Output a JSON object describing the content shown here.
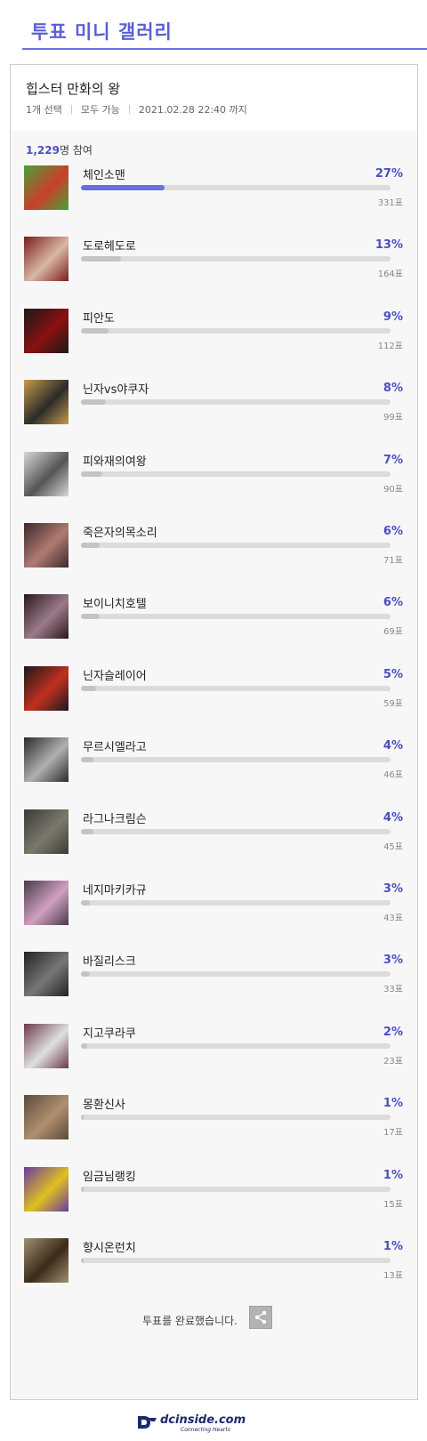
{
  "header": {
    "title": "투표 미니 갤러리"
  },
  "poll": {
    "title": "힙스터 만화의 왕",
    "select_rule": "1개 선택",
    "visibility": "모두 가능",
    "deadline": "2021.02.28 22:40 까지",
    "participants_count": "1,229",
    "participants_suffix": "명 참여",
    "options": [
      {
        "label": "체인소맨",
        "percent": "27%",
        "votes": "331표",
        "fraction": 0.27
      },
      {
        "label": "도로헤도로",
        "percent": "13%",
        "votes": "164표",
        "fraction": 0.13
      },
      {
        "label": "피안도",
        "percent": "9%",
        "votes": "112표",
        "fraction": 0.09
      },
      {
        "label": "닌자vs야쿠자",
        "percent": "8%",
        "votes": "99표",
        "fraction": 0.08
      },
      {
        "label": "피와재의여왕",
        "percent": "7%",
        "votes": "90표",
        "fraction": 0.07
      },
      {
        "label": "죽은자의목소리",
        "percent": "6%",
        "votes": "71표",
        "fraction": 0.06
      },
      {
        "label": "보이니치호텔",
        "percent": "6%",
        "votes": "69표",
        "fraction": 0.06
      },
      {
        "label": "닌자슬레이어",
        "percent": "5%",
        "votes": "59표",
        "fraction": 0.05
      },
      {
        "label": "무르시엘라고",
        "percent": "4%",
        "votes": "46표",
        "fraction": 0.04
      },
      {
        "label": "라그나크림슨",
        "percent": "4%",
        "votes": "45표",
        "fraction": 0.04
      },
      {
        "label": "네지마키카규",
        "percent": "3%",
        "votes": "43표",
        "fraction": 0.03
      },
      {
        "label": "바질리스크",
        "percent": "3%",
        "votes": "33표",
        "fraction": 0.03
      },
      {
        "label": "지고쿠라쿠",
        "percent": "2%",
        "votes": "23표",
        "fraction": 0.02
      },
      {
        "label": "몽환신사",
        "percent": "1%",
        "votes": "17표",
        "fraction": 0.01
      },
      {
        "label": "임금님랭킹",
        "percent": "1%",
        "votes": "15표",
        "fraction": 0.01
      },
      {
        "label": "향시온런치",
        "percent": "1%",
        "votes": "13표",
        "fraction": 0.01
      }
    ],
    "done_text": "투표를 완료했습니다."
  },
  "footer": {
    "logo_text": "dcinside.com",
    "logo_sub": "Connecting Hearts"
  },
  "colors": {
    "accent": "#6b6fe0",
    "percent_text": "#4b4fc4",
    "bar_track": "#dcdcdc",
    "bar_fill": "#c4c4c4"
  },
  "icons": {
    "share": "share-icon",
    "thumbnail": "manga-cover-thumbnail"
  }
}
